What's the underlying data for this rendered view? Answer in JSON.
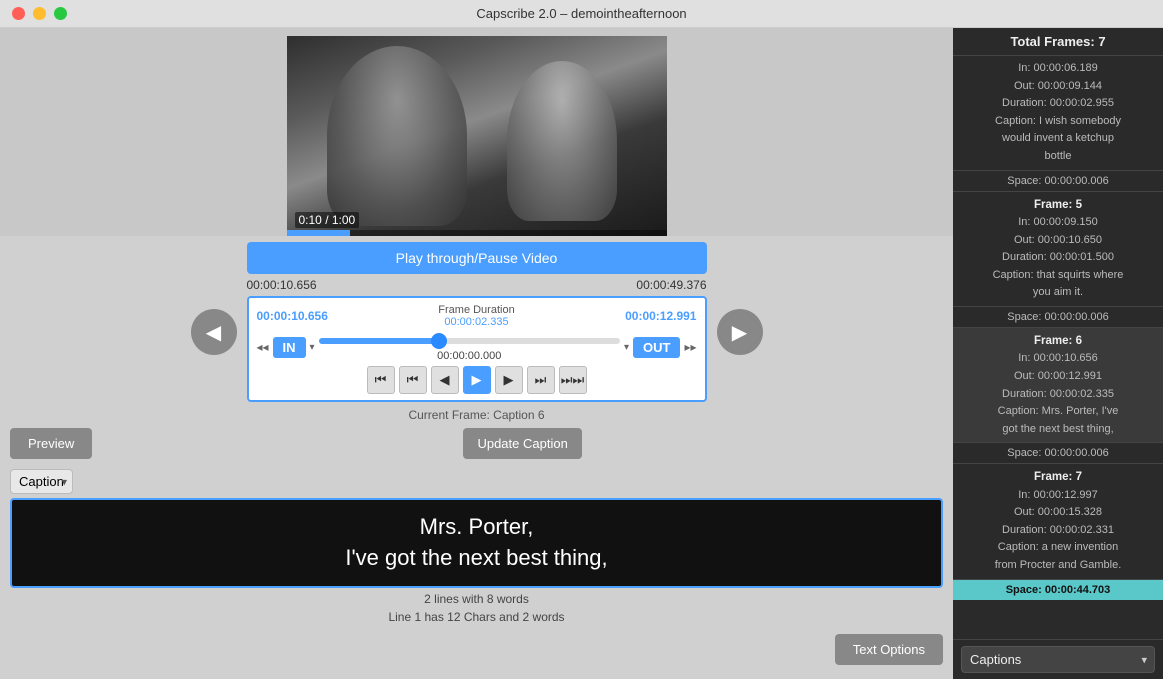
{
  "window": {
    "title": "Capscribe 2.0 – demointheafternoon"
  },
  "video": {
    "time_current": "0:10",
    "time_total": "1:00",
    "time_display": "0:10 / 1:00",
    "progress_percent": 16.7
  },
  "transport": {
    "play_button": "Play through/Pause Video",
    "time_left": "00:00:10.656",
    "time_right": "00:00:49.376",
    "frame_in": "00:00:10.656",
    "frame_out": "00:00:12.991",
    "frame_duration_label": "Frame Duration",
    "frame_duration": "00:00:02.335",
    "scrubber_time": "00:00:00.000",
    "in_btn": "IN",
    "out_btn": "OUT",
    "current_frame_label": "Current Frame: Caption 6"
  },
  "controls": {
    "preview_label": "Preview",
    "update_caption_label": "Update Caption"
  },
  "caption": {
    "dropdown_label": "Caption",
    "text_line1": "Mrs. Porter,",
    "text_line2": "I've got the next best thing,",
    "stats_line1": "2 lines with 8 words",
    "stats_line2": "Line 1 has 12 Chars and 2 words"
  },
  "text_options": {
    "button_label": "Text Options"
  },
  "right_panel": {
    "total_frames": "Total Frames: 7",
    "frames": [
      {
        "id": "frame4_info",
        "in": "In: 00:00:06.189",
        "out": "Out: 00:00:09.144",
        "duration": "Duration: 00:00:02.955",
        "caption": "Caption: I wish somebody would invent a ketchup bottle",
        "selected": false,
        "has_title": false
      },
      {
        "id": "space1",
        "type": "space",
        "value": "Space: 00:00:00.006"
      },
      {
        "id": "frame5",
        "title": "Frame: 5",
        "in": "In: 00:00:09.150",
        "out": "Out: 00:00:10.650",
        "duration": "Duration: 00:00:01.500",
        "caption": "Caption: that squirts where you aim it.",
        "selected": false,
        "has_title": true
      },
      {
        "id": "space2",
        "type": "space",
        "value": "Space: 00:00:00.006"
      },
      {
        "id": "frame6",
        "title": "Frame: 6",
        "in": "In: 00:00:10.656",
        "out": "Out: 00:00:12.991",
        "duration": "Duration: 00:00:02.335",
        "caption": "Caption: Mrs. Porter, I've got the next best thing,",
        "selected": true,
        "has_title": true
      },
      {
        "id": "space3",
        "type": "space",
        "value": "Space: 00:00:00.006"
      },
      {
        "id": "frame7",
        "title": "Frame: 7",
        "in": "In: 00:00:12.997",
        "out": "Out: 00:00:15.328",
        "duration": "Duration: 00:00:02.331",
        "caption": "Caption: a new invention from Procter and Gamble.",
        "selected": false,
        "has_title": true
      },
      {
        "id": "space4",
        "type": "space",
        "value": "Space: 00:00:44.703",
        "highlight": true
      }
    ],
    "footer_select": {
      "options": [
        "Captions"
      ],
      "selected": "Captions"
    }
  }
}
